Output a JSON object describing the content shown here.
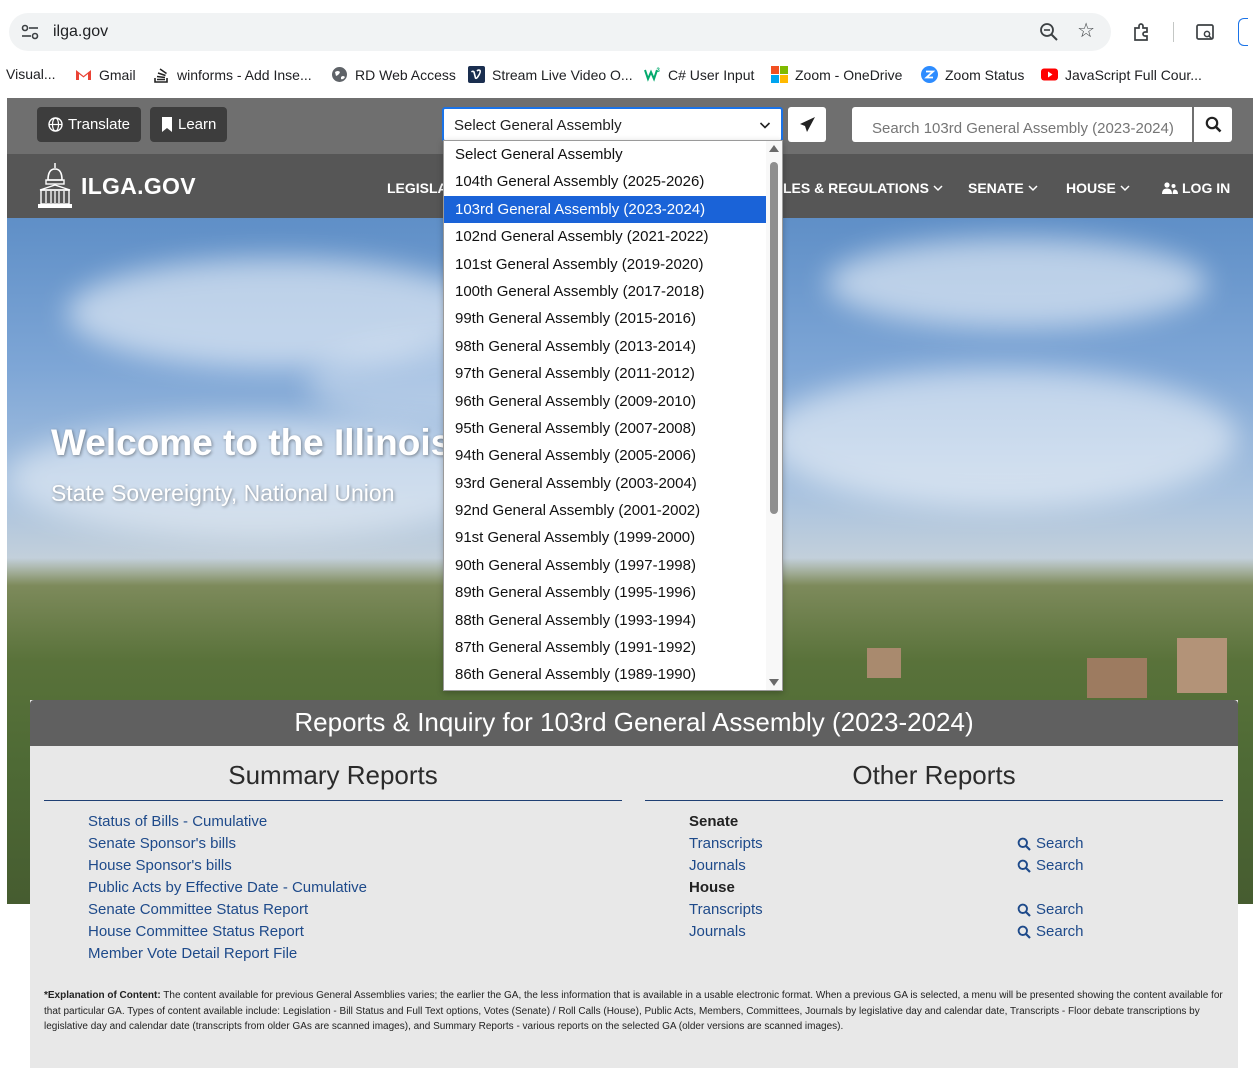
{
  "browser": {
    "url": "ilga.gov",
    "bookmarks": [
      {
        "label": "Visual...",
        "icon": "none"
      },
      {
        "label": "Gmail",
        "icon": "gmail-icon"
      },
      {
        "label": "winforms - Add Inse...",
        "icon": "stackoverflow-icon"
      },
      {
        "label": "RD Web Access",
        "icon": "globe-icon"
      },
      {
        "label": "Stream Live Video O...",
        "icon": "vimeo-icon"
      },
      {
        "label": "C# User Input",
        "icon": "w3schools-icon"
      },
      {
        "label": "Zoom - OneDrive",
        "icon": "microsoft-icon"
      },
      {
        "label": "Zoom Status",
        "icon": "zoom-icon"
      },
      {
        "label": "JavaScript Full Cour...",
        "icon": "youtube-icon"
      }
    ]
  },
  "utility": {
    "translate_label": "Translate",
    "learn_label": "Learn",
    "select_value": "Select General Assembly",
    "search_placeholder": "Search 103rd General Assembly (2023-2024)"
  },
  "nav": {
    "logo": "ILGA.GOV",
    "items": [
      "LEGISLA",
      "LES & REGULATIONS",
      "SENATE",
      "HOUSE",
      "LOG IN"
    ]
  },
  "hero": {
    "title": "Welcome to the Illinois",
    "subtitle": "State Sovereignty, National Union"
  },
  "dropdown": {
    "options": [
      "Select General Assembly",
      "104th General Assembly (2025-2026)",
      "103rd General Assembly (2023-2024)",
      "102nd General Assembly (2021-2022)",
      "101st General Assembly (2019-2020)",
      "100th General Assembly (2017-2018)",
      "99th General Assembly (2015-2016)",
      "98th General Assembly (2013-2014)",
      "97th General Assembly (2011-2012)",
      "96th General Assembly (2009-2010)",
      "95th General Assembly (2007-2008)",
      "94th General Assembly (2005-2006)",
      "93rd General Assembly (2003-2004)",
      "92nd General Assembly (2001-2002)",
      "91st General Assembly (1999-2000)",
      "90th General Assembly (1997-1998)",
      "89th General Assembly (1995-1996)",
      "88th General Assembly (1993-1994)",
      "87th General Assembly (1991-1992)",
      "86th General Assembly (1989-1990)"
    ],
    "selected_index": 2
  },
  "reports": {
    "heading": "Reports & Inquiry for 103rd General Assembly (2023-2024)",
    "summary_title": "Summary Reports",
    "summary_links": [
      "Status of Bills - Cumulative",
      "Senate Sponsor's bills",
      "House Sponsor's bills",
      "Public Acts by Effective Date - Cumulative",
      "Senate Committee Status Report",
      "House Committee Status Report",
      "Member Vote Detail Report File"
    ],
    "other_title": "Other Reports",
    "senate_label": "Senate",
    "house_label": "House",
    "transcripts_label": "Transcripts",
    "journals_label": "Journals",
    "search_label": "Search",
    "explanation_lead": "*Explanation of Content:",
    "explanation_text": " The content available for previous General Assemblies varies; the earlier the GA, the less information that is available in a usable electronic format. When a previous GA is selected, a menu will be presented showing the content available for that particular GA. Types of content available include: Legislation - Bill Status and Full Text options, Votes (Senate) / Roll Calls (House), Public Acts, Members, Committees, Journals by legislative day and calendar date, Transcripts - Floor debate transcriptions by legislative day and calendar date (transcripts from older GAs are scanned images), and Summary Reports - various reports on the selected GA (older versions are scanned images)."
  },
  "colors": {
    "select_focus": "#1a73e8",
    "selected_option": "#1a63d8",
    "link": "#1e4a8a",
    "nav_bg": "#565656",
    "util_bg": "#6f6f6f"
  }
}
